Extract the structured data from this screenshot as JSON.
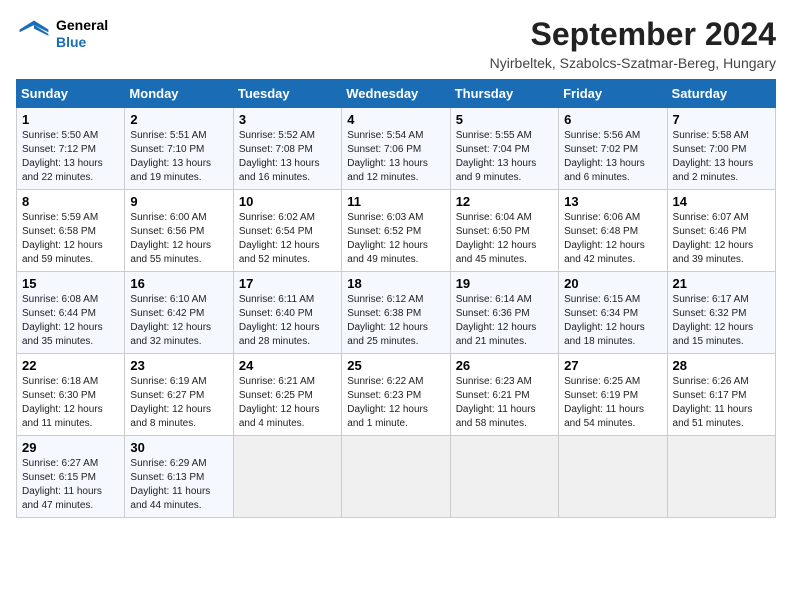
{
  "header": {
    "logo": {
      "general": "General",
      "blue": "Blue"
    },
    "title": "September 2024",
    "location": "Nyirbeltek, Szabolcs-Szatmar-Bereg, Hungary"
  },
  "calendar": {
    "weekdays": [
      "Sunday",
      "Monday",
      "Tuesday",
      "Wednesday",
      "Thursday",
      "Friday",
      "Saturday"
    ],
    "weeks": [
      [
        {
          "day": "1",
          "content": "Sunrise: 5:50 AM\nSunset: 7:12 PM\nDaylight: 13 hours\nand 22 minutes."
        },
        {
          "day": "2",
          "content": "Sunrise: 5:51 AM\nSunset: 7:10 PM\nDaylight: 13 hours\nand 19 minutes."
        },
        {
          "day": "3",
          "content": "Sunrise: 5:52 AM\nSunset: 7:08 PM\nDaylight: 13 hours\nand 16 minutes."
        },
        {
          "day": "4",
          "content": "Sunrise: 5:54 AM\nSunset: 7:06 PM\nDaylight: 13 hours\nand 12 minutes."
        },
        {
          "day": "5",
          "content": "Sunrise: 5:55 AM\nSunset: 7:04 PM\nDaylight: 13 hours\nand 9 minutes."
        },
        {
          "day": "6",
          "content": "Sunrise: 5:56 AM\nSunset: 7:02 PM\nDaylight: 13 hours\nand 6 minutes."
        },
        {
          "day": "7",
          "content": "Sunrise: 5:58 AM\nSunset: 7:00 PM\nDaylight: 13 hours\nand 2 minutes."
        }
      ],
      [
        {
          "day": "8",
          "content": "Sunrise: 5:59 AM\nSunset: 6:58 PM\nDaylight: 12 hours\nand 59 minutes."
        },
        {
          "day": "9",
          "content": "Sunrise: 6:00 AM\nSunset: 6:56 PM\nDaylight: 12 hours\nand 55 minutes."
        },
        {
          "day": "10",
          "content": "Sunrise: 6:02 AM\nSunset: 6:54 PM\nDaylight: 12 hours\nand 52 minutes."
        },
        {
          "day": "11",
          "content": "Sunrise: 6:03 AM\nSunset: 6:52 PM\nDaylight: 12 hours\nand 49 minutes."
        },
        {
          "day": "12",
          "content": "Sunrise: 6:04 AM\nSunset: 6:50 PM\nDaylight: 12 hours\nand 45 minutes."
        },
        {
          "day": "13",
          "content": "Sunrise: 6:06 AM\nSunset: 6:48 PM\nDaylight: 12 hours\nand 42 minutes."
        },
        {
          "day": "14",
          "content": "Sunrise: 6:07 AM\nSunset: 6:46 PM\nDaylight: 12 hours\nand 39 minutes."
        }
      ],
      [
        {
          "day": "15",
          "content": "Sunrise: 6:08 AM\nSunset: 6:44 PM\nDaylight: 12 hours\nand 35 minutes."
        },
        {
          "day": "16",
          "content": "Sunrise: 6:10 AM\nSunset: 6:42 PM\nDaylight: 12 hours\nand 32 minutes."
        },
        {
          "day": "17",
          "content": "Sunrise: 6:11 AM\nSunset: 6:40 PM\nDaylight: 12 hours\nand 28 minutes."
        },
        {
          "day": "18",
          "content": "Sunrise: 6:12 AM\nSunset: 6:38 PM\nDaylight: 12 hours\nand 25 minutes."
        },
        {
          "day": "19",
          "content": "Sunrise: 6:14 AM\nSunset: 6:36 PM\nDaylight: 12 hours\nand 21 minutes."
        },
        {
          "day": "20",
          "content": "Sunrise: 6:15 AM\nSunset: 6:34 PM\nDaylight: 12 hours\nand 18 minutes."
        },
        {
          "day": "21",
          "content": "Sunrise: 6:17 AM\nSunset: 6:32 PM\nDaylight: 12 hours\nand 15 minutes."
        }
      ],
      [
        {
          "day": "22",
          "content": "Sunrise: 6:18 AM\nSunset: 6:30 PM\nDaylight: 12 hours\nand 11 minutes."
        },
        {
          "day": "23",
          "content": "Sunrise: 6:19 AM\nSunset: 6:27 PM\nDaylight: 12 hours\nand 8 minutes."
        },
        {
          "day": "24",
          "content": "Sunrise: 6:21 AM\nSunset: 6:25 PM\nDaylight: 12 hours\nand 4 minutes."
        },
        {
          "day": "25",
          "content": "Sunrise: 6:22 AM\nSunset: 6:23 PM\nDaylight: 12 hours\nand 1 minute."
        },
        {
          "day": "26",
          "content": "Sunrise: 6:23 AM\nSunset: 6:21 PM\nDaylight: 11 hours\nand 58 minutes."
        },
        {
          "day": "27",
          "content": "Sunrise: 6:25 AM\nSunset: 6:19 PM\nDaylight: 11 hours\nand 54 minutes."
        },
        {
          "day": "28",
          "content": "Sunrise: 6:26 AM\nSunset: 6:17 PM\nDaylight: 11 hours\nand 51 minutes."
        }
      ],
      [
        {
          "day": "29",
          "content": "Sunrise: 6:27 AM\nSunset: 6:15 PM\nDaylight: 11 hours\nand 47 minutes."
        },
        {
          "day": "30",
          "content": "Sunrise: 6:29 AM\nSunset: 6:13 PM\nDaylight: 11 hours\nand 44 minutes."
        },
        {
          "day": "",
          "content": ""
        },
        {
          "day": "",
          "content": ""
        },
        {
          "day": "",
          "content": ""
        },
        {
          "day": "",
          "content": ""
        },
        {
          "day": "",
          "content": ""
        }
      ]
    ]
  }
}
